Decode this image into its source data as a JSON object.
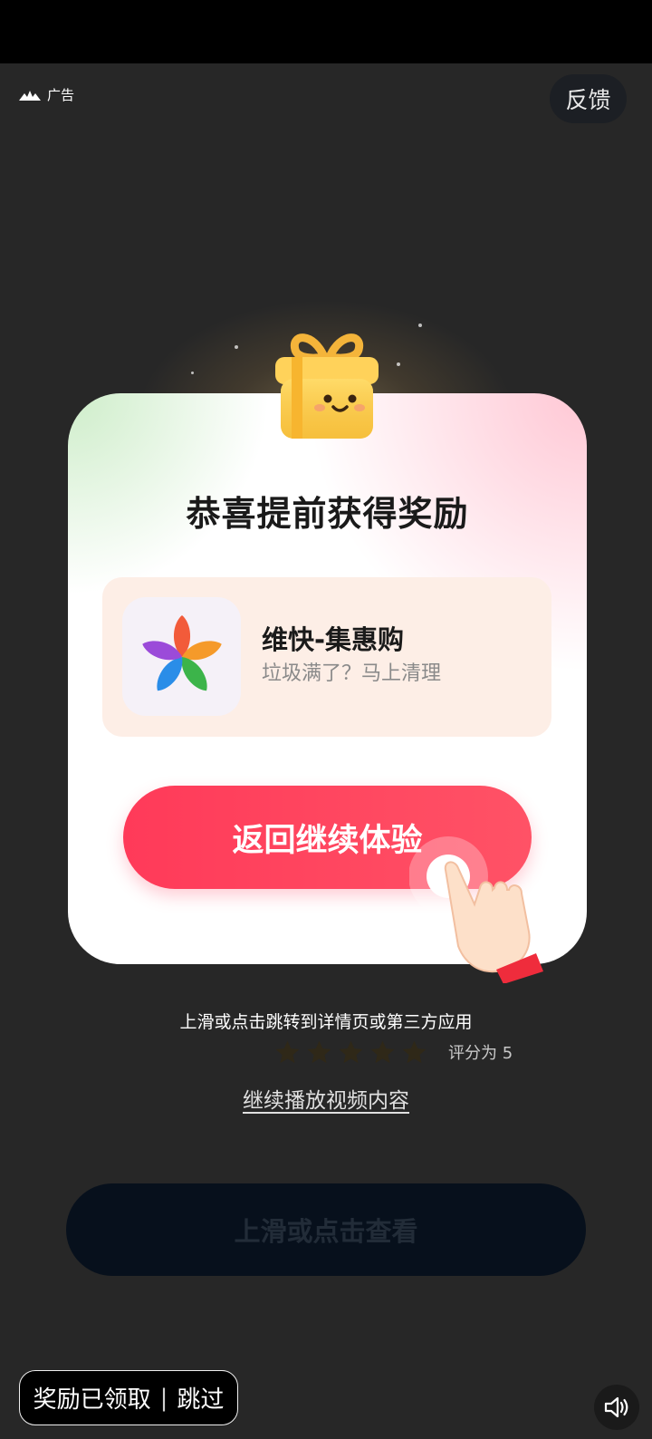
{
  "ad": {
    "label": "广告"
  },
  "feedback": {
    "label": "反馈"
  },
  "dialog": {
    "title": "恭喜提前获得奖励",
    "app_name": "维快-集惠购",
    "app_desc": "垃圾满了？马上清理",
    "cta_label": "返回继续体验"
  },
  "hint": "上滑或点击跳转到详情页或第三方应用",
  "rating": {
    "stars": 5,
    "text": "评分为 5"
  },
  "continue_link": "继续播放视频内容",
  "view_button": "上滑或点击查看",
  "skip": {
    "reward_label": "奖励已领取",
    "skip_label": "跳过"
  },
  "colors": {
    "cta": "#ff3a59",
    "background": "#272727",
    "view_button": "#07101c"
  },
  "icons": [
    "ad-logo-icon",
    "gift-icon",
    "app-flower-icon",
    "hand-pointer-icon",
    "star-icon",
    "speaker-icon"
  ]
}
